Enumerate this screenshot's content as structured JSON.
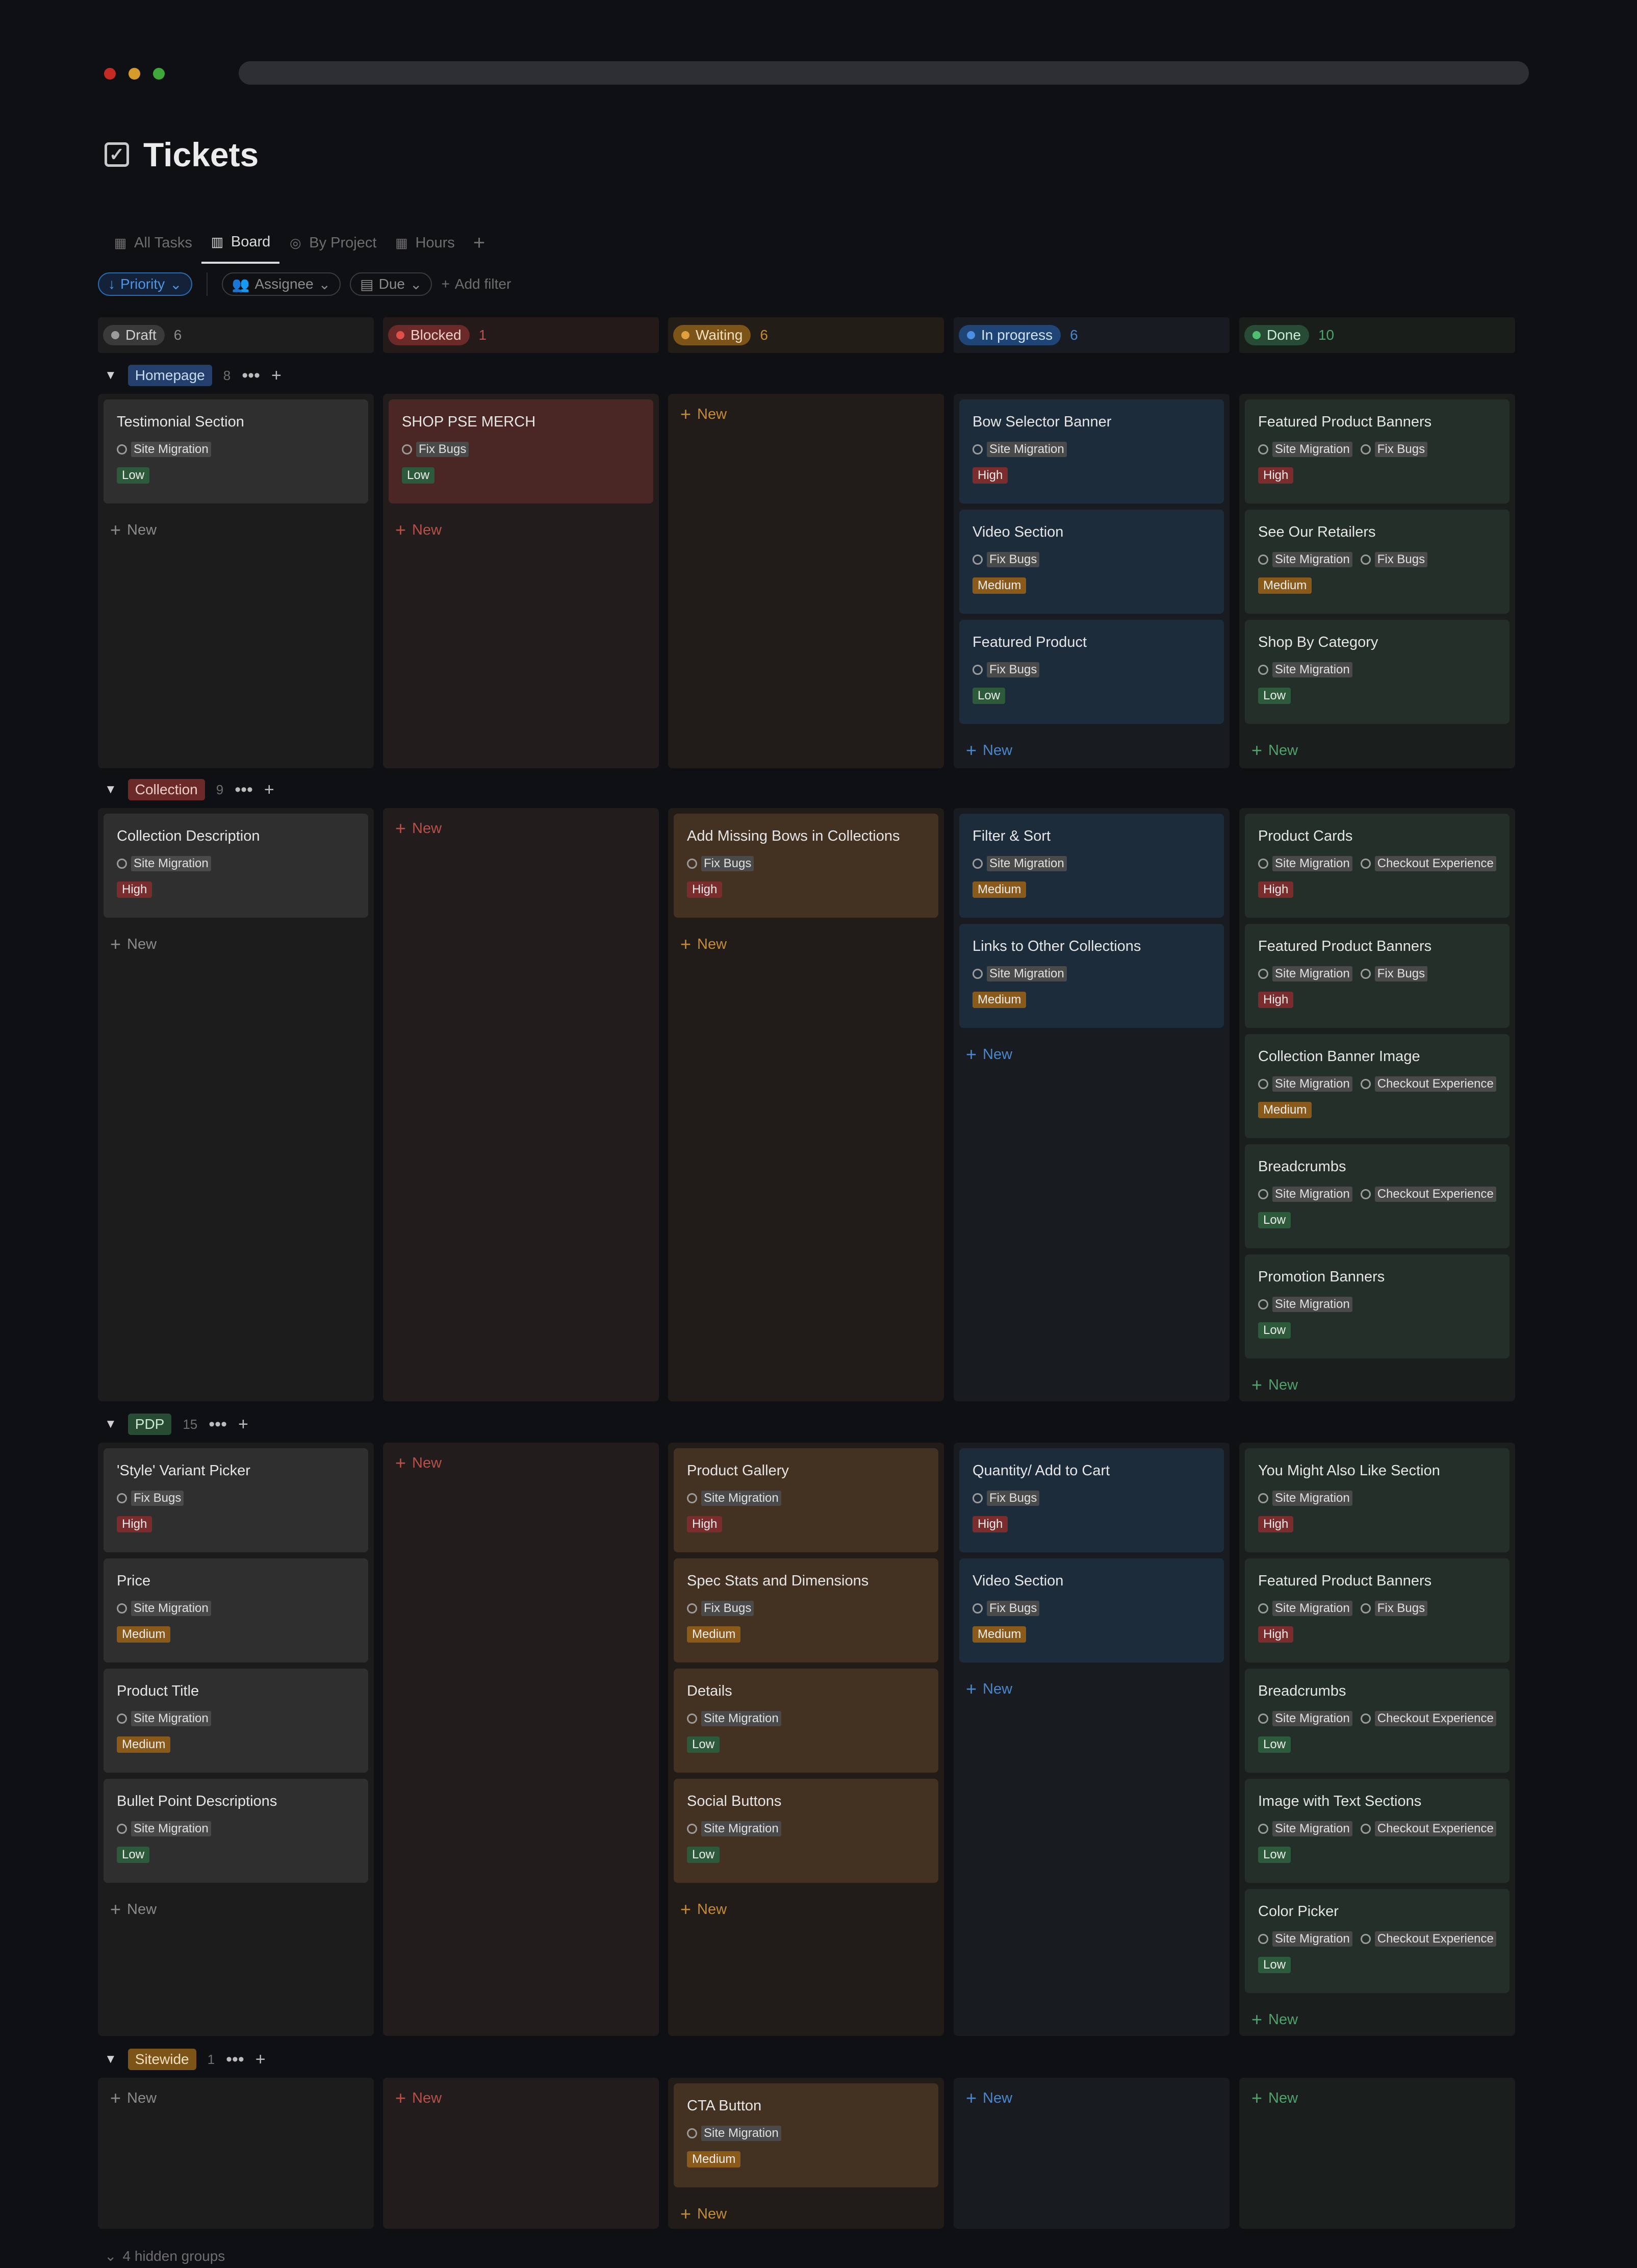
{
  "page": {
    "title": "Tickets",
    "hidden_groups_label": "4 hidden groups"
  },
  "tabs": [
    {
      "label": "All Tasks",
      "icon": "table-icon"
    },
    {
      "label": "Board",
      "icon": "board-icon",
      "active": true
    },
    {
      "label": "By Project",
      "icon": "target-icon"
    },
    {
      "label": "Hours",
      "icon": "table-icon"
    }
  ],
  "filters": {
    "priority": "Priority",
    "assignee": "Assignee",
    "due": "Due",
    "add_filter": "Add filter"
  },
  "new_label": "New",
  "columns": [
    {
      "label": "Draft",
      "count": "6",
      "dot": "#9b9b9b",
      "pill_bg": "#3a3a3a",
      "text": "#d0d0d0",
      "cnt_color": "#8a8a8a",
      "head_bg": "#1d1d1e",
      "col_bg": "#1c1c1d",
      "card_bg": "#2f2f2f",
      "new_color": "#8a8a8a"
    },
    {
      "label": "Blocked",
      "count": "1",
      "dot": "#e0504a",
      "pill_bg": "#6b2a28",
      "text": "#f0d0cc",
      "cnt_color": "#c0524a",
      "head_bg": "#231a19",
      "col_bg": "#221d1c",
      "card_bg": "#4a2724",
      "new_color": "#b6504a"
    },
    {
      "label": "Waiting",
      "count": "6",
      "dot": "#e0a040",
      "pill_bg": "#7d5418",
      "text": "#f3e0c0",
      "cnt_color": "#c58a34",
      "head_bg": "#221d17",
      "col_bg": "#211c17",
      "card_bg": "#433121",
      "new_color": "#c58a34"
    },
    {
      "label": "In progress",
      "count": "6",
      "dot": "#4a8fe0",
      "pill_bg": "#1f4577",
      "text": "#d0e3f7",
      "cnt_color": "#4a86cc",
      "head_bg": "#181c22",
      "col_bg": "#181c21",
      "card_bg": "#1d2c3b",
      "new_color": "#4a86cc"
    },
    {
      "label": "Done",
      "count": "10",
      "dot": "#4fbf72",
      "pill_bg": "#274b34",
      "text": "#cfeed8",
      "cnt_color": "#4fa36a",
      "head_bg": "#1a1e1b",
      "col_bg": "#1a1e1c",
      "card_bg": "#232f28",
      "new_color": "#4fa36a"
    }
  ],
  "groups": [
    {
      "name": "Homepage",
      "count": "8",
      "tag_bg": "#243f6b",
      "tag_color": "#c9dcf3",
      "cells": [
        [
          {
            "title": "Testimonial Section",
            "tags": [
              "Site Migration"
            ],
            "priority": "Low"
          }
        ],
        [
          {
            "title": "SHOP PSE MERCH",
            "tags": [
              "Fix Bugs"
            ],
            "priority": "Low"
          }
        ],
        [],
        [
          {
            "title": "Bow Selector Banner",
            "tags": [
              "Site Migration"
            ],
            "priority": "High"
          },
          {
            "title": "Video Section",
            "tags": [
              "Fix Bugs"
            ],
            "priority": "Medium"
          },
          {
            "title": "Featured Product",
            "tags": [
              "Fix Bugs"
            ],
            "priority": "Low"
          }
        ],
        [
          {
            "title": "Featured Product Banners",
            "tags": [
              "Site Migration",
              "Fix Bugs"
            ],
            "priority": "High"
          },
          {
            "title": "See Our Retailers",
            "tags": [
              "Site Migration",
              "Fix Bugs"
            ],
            "priority": "Medium"
          },
          {
            "title": "Shop By Category",
            "tags": [
              "Site Migration"
            ],
            "priority": "Low"
          }
        ]
      ]
    },
    {
      "name": "Collection",
      "count": "9",
      "tag_bg": "#6b2a28",
      "tag_color": "#f0cfcb",
      "cells": [
        [
          {
            "title": "Collection Description",
            "tags": [
              "Site Migration"
            ],
            "priority": "High"
          }
        ],
        [],
        [
          {
            "title": "Add Missing Bows in Collections",
            "tags": [
              "Fix Bugs"
            ],
            "priority": "High"
          }
        ],
        [
          {
            "title": "Filter & Sort",
            "tags": [
              "Site Migration"
            ],
            "priority": "Medium"
          },
          {
            "title": "Links to Other Collections",
            "tags": [
              "Site Migration"
            ],
            "priority": "Medium"
          }
        ],
        [
          {
            "title": "Product Cards",
            "tags": [
              "Site Migration",
              "Checkout Experience"
            ],
            "priority": "High"
          },
          {
            "title": "Featured Product Banners",
            "tags": [
              "Site Migration",
              "Fix Bugs"
            ],
            "priority": "High"
          },
          {
            "title": "Collection Banner  Image",
            "tags": [
              "Site Migration",
              "Checkout Experience"
            ],
            "priority": "Medium"
          },
          {
            "title": "Breadcrumbs",
            "tags": [
              "Site Migration",
              "Checkout Experience"
            ],
            "priority": "Low"
          },
          {
            "title": "Promotion Banners",
            "tags": [
              "Site Migration"
            ],
            "priority": "Low"
          }
        ]
      ]
    },
    {
      "name": "PDP",
      "count": "15",
      "tag_bg": "#284b33",
      "tag_color": "#cde9d4",
      "cells": [
        [
          {
            "title": "'Style' Variant Picker",
            "tags": [
              "Fix Bugs"
            ],
            "priority": "High"
          },
          {
            "title": "Price",
            "tags": [
              "Site Migration"
            ],
            "priority": "Medium"
          },
          {
            "title": "Product Title",
            "tags": [
              "Site Migration"
            ],
            "priority": "Medium"
          },
          {
            "title": "Bullet Point Descriptions",
            "tags": [
              "Site Migration"
            ],
            "priority": "Low"
          }
        ],
        [],
        [
          {
            "title": "Product Gallery",
            "tags": [
              "Site Migration"
            ],
            "priority": "High"
          },
          {
            "title": "Spec Stats and Dimensions",
            "tags": [
              "Fix Bugs"
            ],
            "priority": "Medium"
          },
          {
            "title": "Details",
            "tags": [
              "Site Migration"
            ],
            "priority": "Low"
          },
          {
            "title": "Social Buttons",
            "tags": [
              "Site Migration"
            ],
            "priority": "Low"
          }
        ],
        [
          {
            "title": "Quantity/ Add to Cart",
            "tags": [
              "Fix Bugs"
            ],
            "priority": "High"
          },
          {
            "title": "Video Section",
            "tags": [
              "Fix Bugs"
            ],
            "priority": "Medium"
          }
        ],
        [
          {
            "title": "You Might Also Like Section",
            "tags": [
              "Site Migration"
            ],
            "priority": "High"
          },
          {
            "title": "Featured Product Banners",
            "tags": [
              "Site Migration",
              "Fix Bugs"
            ],
            "priority": "High"
          },
          {
            "title": "Breadcrumbs",
            "tags": [
              "Site Migration",
              "Checkout Experience"
            ],
            "priority": "Low"
          },
          {
            "title": "Image with Text Sections",
            "tags": [
              "Site Migration",
              "Checkout Experience"
            ],
            "priority": "Low"
          },
          {
            "title": "Color Picker",
            "tags": [
              "Site Migration",
              "Checkout Experience"
            ],
            "priority": "Low"
          }
        ]
      ]
    },
    {
      "name": "Sitewide",
      "count": "1",
      "tag_bg": "#7d5418",
      "tag_color": "#f3e0c0",
      "cells": [
        [],
        [],
        [
          {
            "title": "CTA Button",
            "tags": [
              "Site Migration"
            ],
            "priority": "Medium"
          }
        ],
        [],
        []
      ]
    }
  ]
}
